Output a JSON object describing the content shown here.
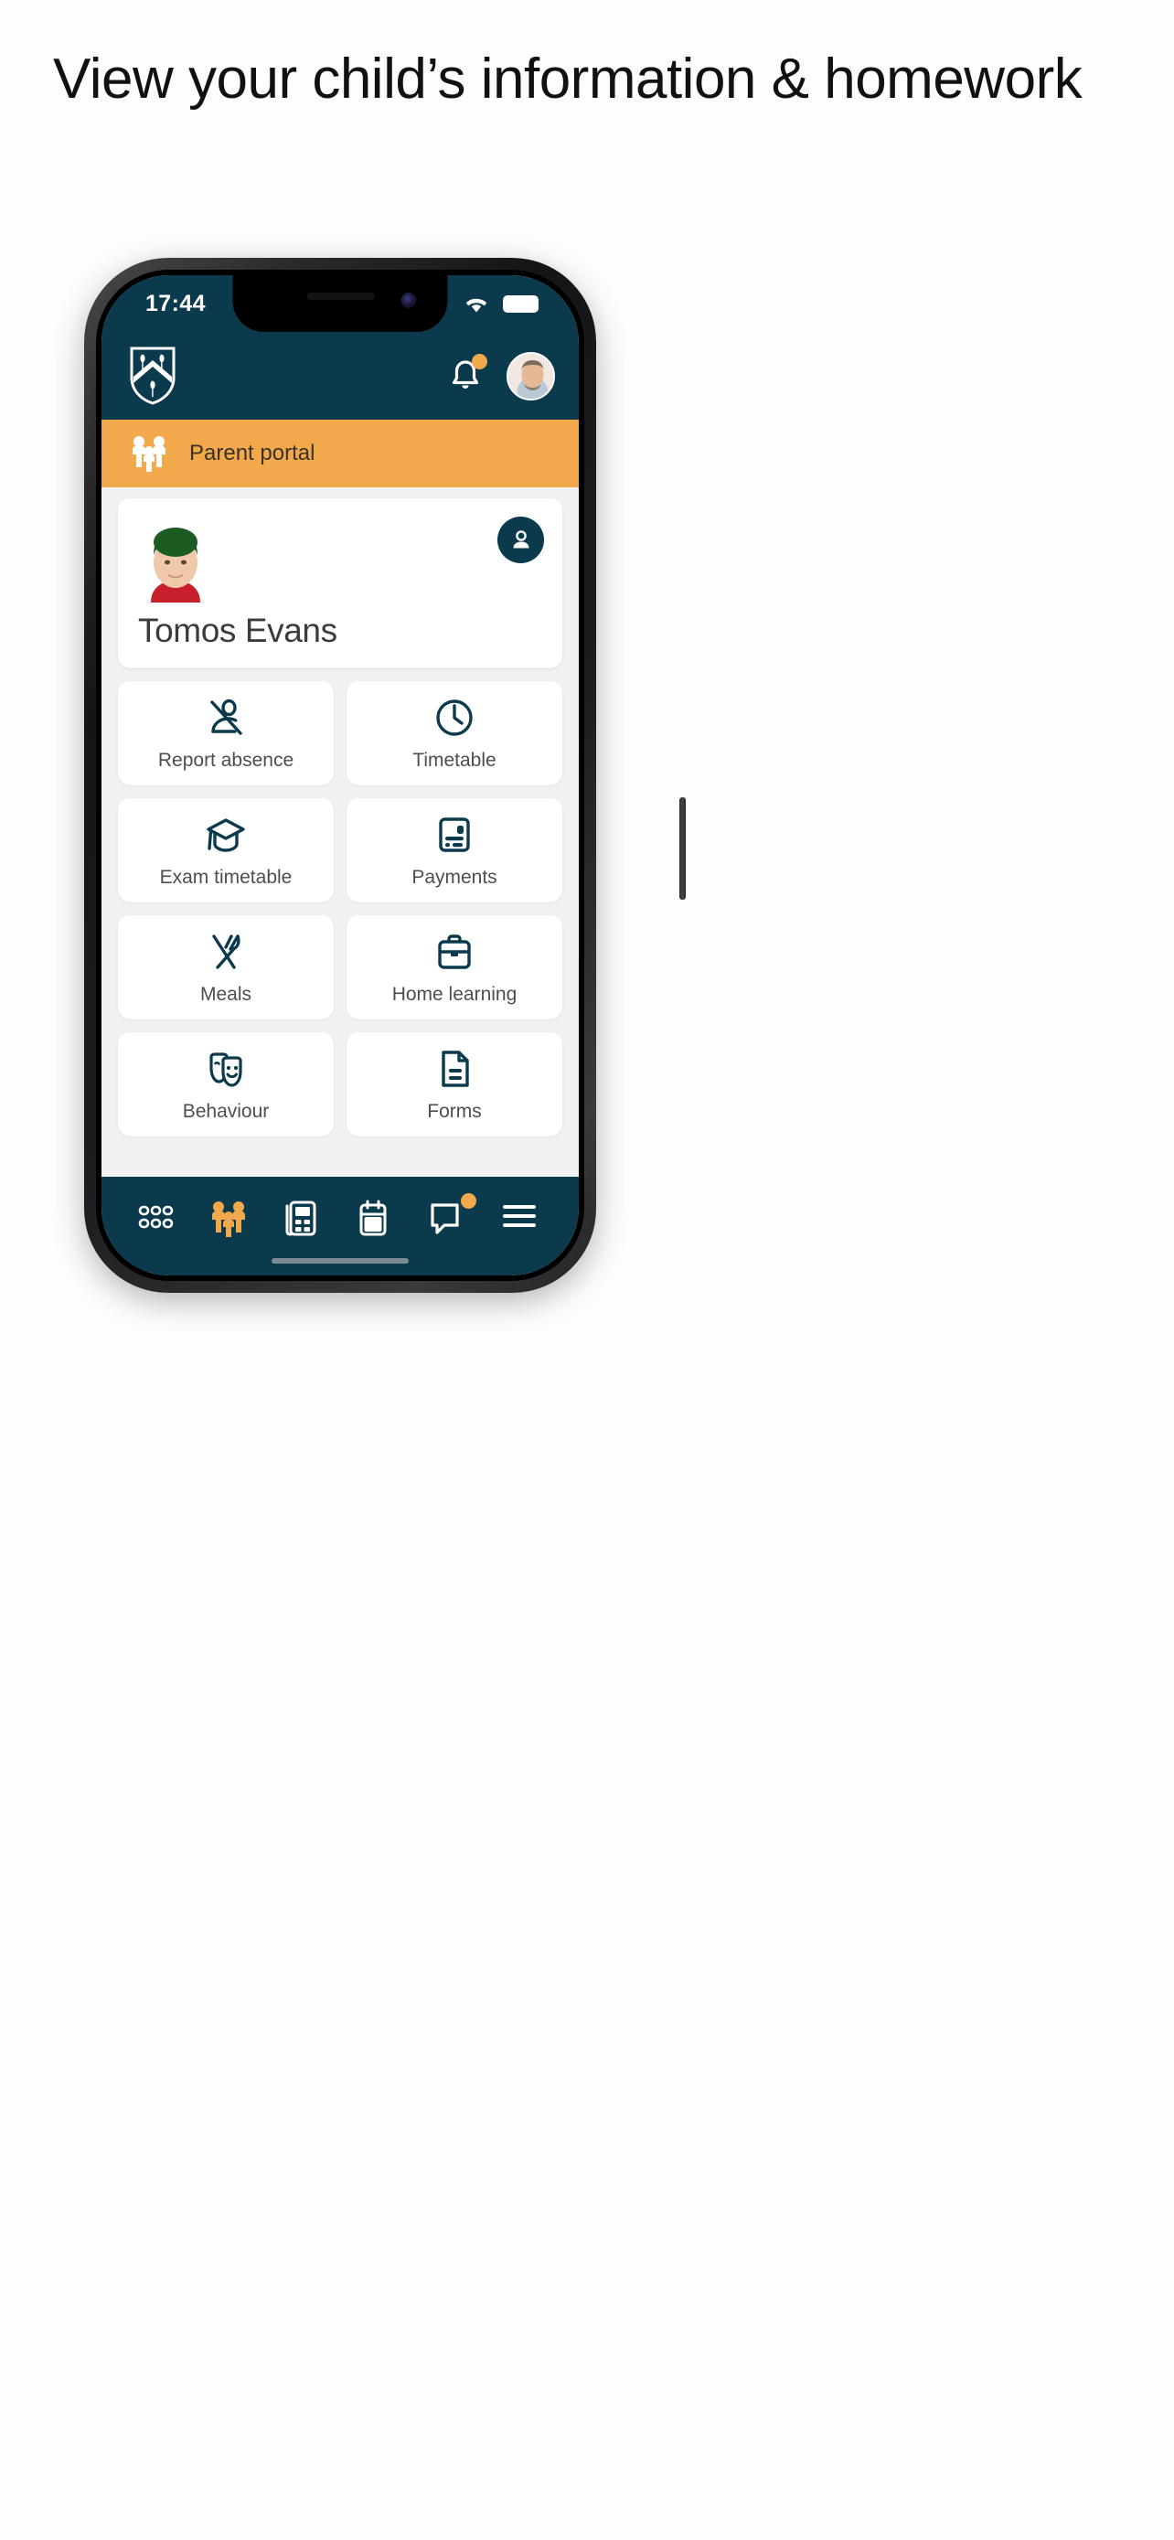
{
  "headline": "View your child’s information & homework",
  "status_bar": {
    "time": "17:44",
    "wifi_icon": "wifi-icon",
    "battery_icon": "battery-full-icon"
  },
  "app_header": {
    "logo_icon": "school-crest-icon",
    "notification_icon": "bell-icon",
    "notification_badge": true,
    "avatar_icon": "user-avatar-image"
  },
  "portal_bar": {
    "icon": "family-icon",
    "label": "Parent portal",
    "color": "#f2a94b"
  },
  "student_card": {
    "name": "Tomos Evans",
    "photo_icon": "student-photo",
    "badge_icon": "person-icon"
  },
  "tiles": [
    {
      "label": "Report absence",
      "icon": "person-absent-icon"
    },
    {
      "label": "Timetable",
      "icon": "clock-icon"
    },
    {
      "label": "Exam timetable",
      "icon": "graduation-cap-icon"
    },
    {
      "label": "Payments",
      "icon": "payment-card-icon"
    },
    {
      "label": "Meals",
      "icon": "cutlery-icon"
    },
    {
      "label": "Home learning",
      "icon": "briefcase-icon"
    },
    {
      "label": "Behaviour",
      "icon": "theatre-masks-icon"
    },
    {
      "label": "Forms",
      "icon": "document-icon"
    }
  ],
  "tabbar": {
    "items": [
      {
        "name": "apps",
        "icon": "grid-dots-icon",
        "active": false,
        "badge": false
      },
      {
        "name": "family",
        "icon": "family-icon",
        "active": true,
        "badge": false
      },
      {
        "name": "news",
        "icon": "newspaper-icon",
        "active": false,
        "badge": false
      },
      {
        "name": "calendar",
        "icon": "calendar-icon",
        "active": false,
        "badge": false
      },
      {
        "name": "messages",
        "icon": "chat-icon",
        "active": false,
        "badge": true
      },
      {
        "name": "menu",
        "icon": "hamburger-icon",
        "active": false,
        "badge": false
      }
    ]
  },
  "theme": {
    "primary": "#0b3a4d",
    "accent": "#f2a94b",
    "surface": "#ffffff",
    "background": "#f1f1f1",
    "text": "#4e4e4e"
  }
}
